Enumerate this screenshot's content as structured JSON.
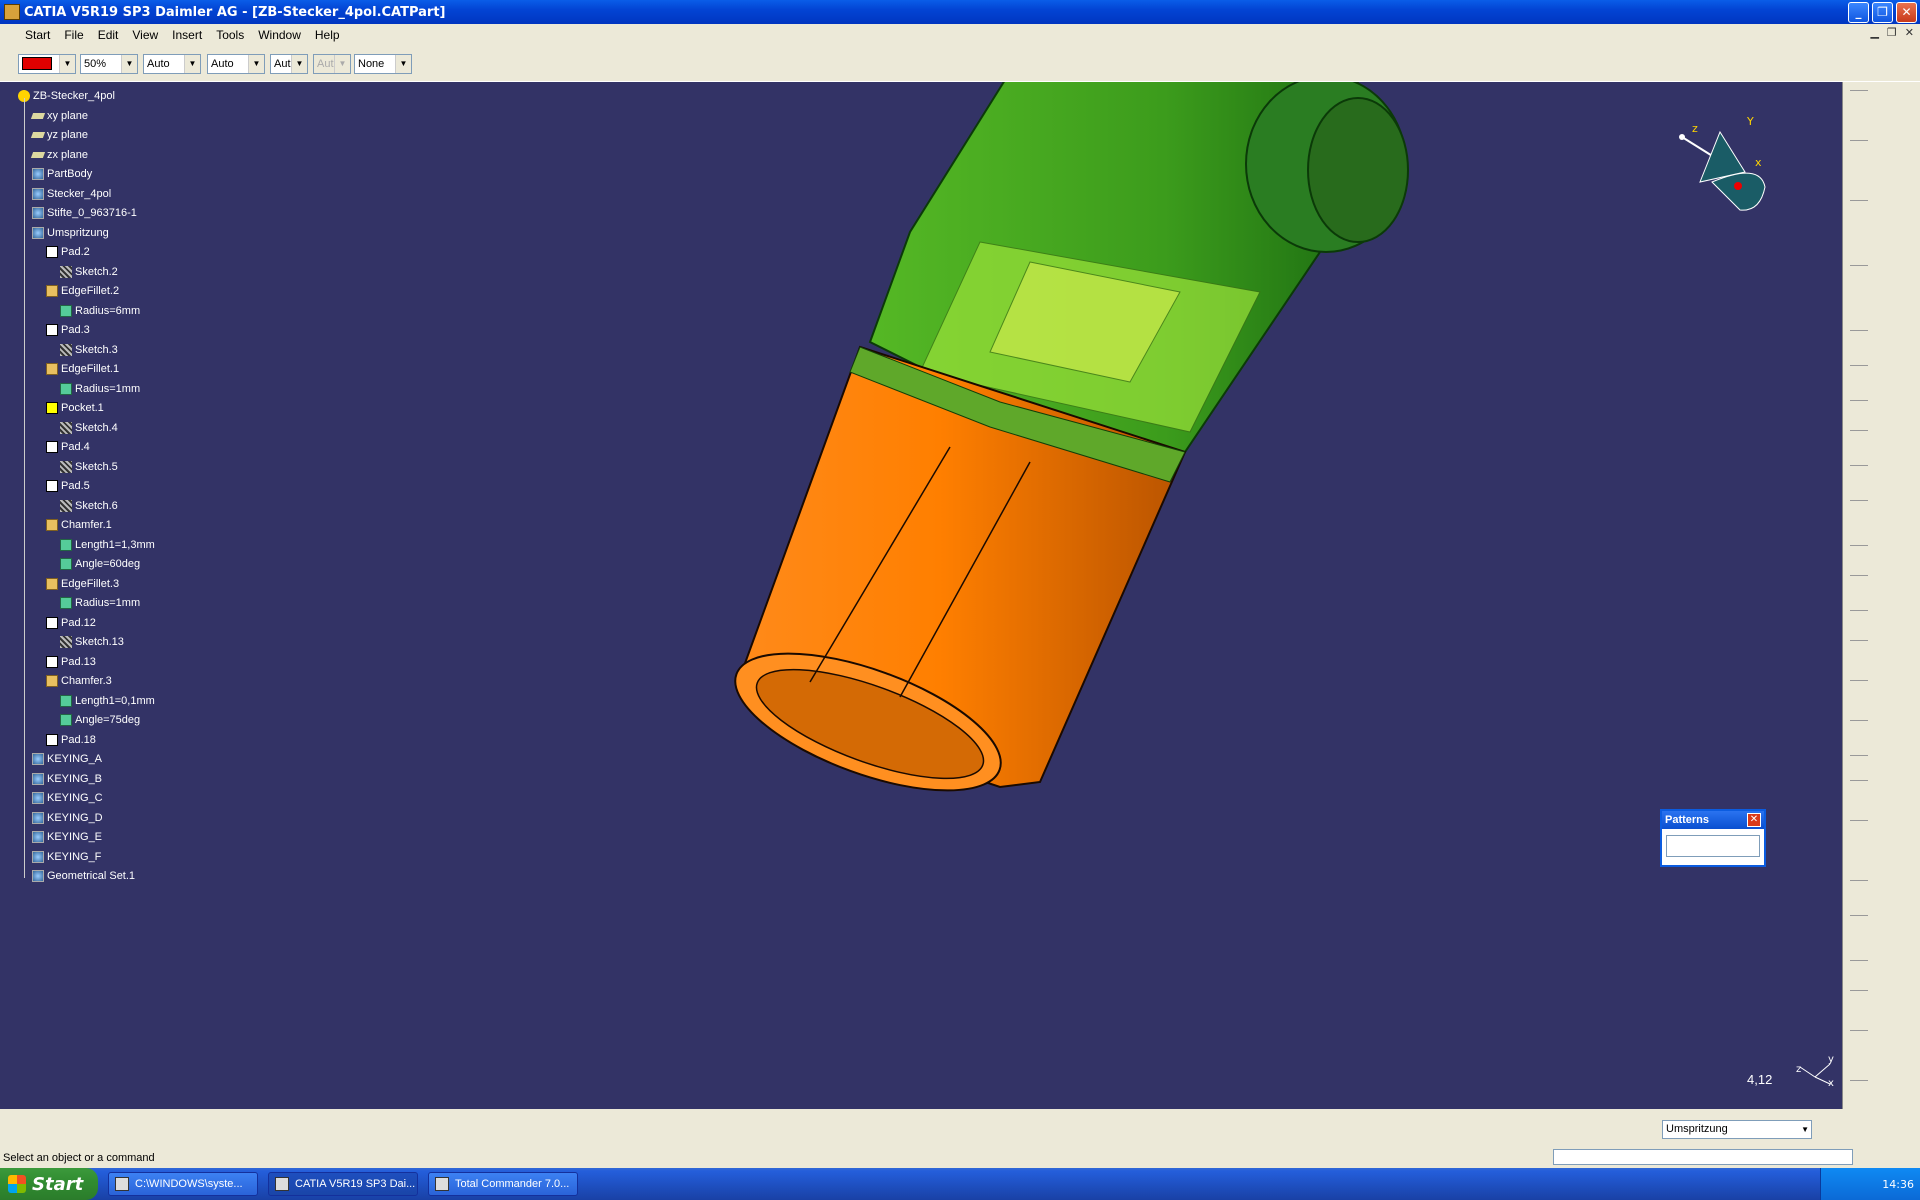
{
  "window": {
    "title": "CATIA V5R19 SP3 Daimler AG - [ZB-Stecker_4pol.CATPart]"
  },
  "menu": [
    "Start",
    "File",
    "Edit",
    "View",
    "Insert",
    "Tools",
    "Window",
    "Help"
  ],
  "toolbar": {
    "color": "#e00000",
    "transparency": "50%",
    "linetype": "Auto",
    "thickness": "Auto",
    "point": "Aut",
    "layer_disabled": "Aut",
    "layer": "None"
  },
  "tree": {
    "root": "ZB-Stecker_4pol",
    "nodes": [
      {
        "label": "xy plane",
        "icon": "plane-icon"
      },
      {
        "label": "yz plane",
        "icon": "plane-icon"
      },
      {
        "label": "zx plane",
        "icon": "plane-icon"
      },
      {
        "label": "PartBody",
        "icon": "body-icon"
      },
      {
        "label": "Stecker_4pol",
        "icon": "body-icon"
      },
      {
        "label": "Stifte_0_963716-1",
        "icon": "body-icon"
      },
      {
        "label": "Umspritzung",
        "icon": "body-icon"
      },
      {
        "label": "Pad.2",
        "icon": "pad-icon"
      },
      {
        "label": "Sketch.2",
        "icon": "sketch-icon"
      },
      {
        "label": "EdgeFillet.2",
        "icon": "fillet-icon"
      },
      {
        "label": "Radius=6mm",
        "icon": "parameter-icon"
      },
      {
        "label": "Pad.3",
        "icon": "pad-icon"
      },
      {
        "label": "Sketch.3",
        "icon": "sketch-icon"
      },
      {
        "label": "EdgeFillet.1",
        "icon": "fillet-icon"
      },
      {
        "label": "Radius=1mm",
        "icon": "parameter-icon"
      },
      {
        "label": "Pocket.1",
        "icon": "pocket-icon"
      },
      {
        "label": "Sketch.4",
        "icon": "sketch-icon"
      },
      {
        "label": "Pad.4",
        "icon": "pad-icon"
      },
      {
        "label": "Sketch.5",
        "icon": "sketch-icon"
      },
      {
        "label": "Pad.5",
        "icon": "pad-icon"
      },
      {
        "label": "Sketch.6",
        "icon": "sketch-icon"
      },
      {
        "label": "Chamfer.1",
        "icon": "chamfer-icon"
      },
      {
        "label": "Length1=1,3mm",
        "icon": "parameter-icon"
      },
      {
        "label": "Angle=60deg",
        "icon": "parameter-icon"
      },
      {
        "label": "EdgeFillet.3",
        "icon": "fillet-icon"
      },
      {
        "label": "Radius=1mm",
        "icon": "parameter-icon"
      },
      {
        "label": "Pad.12",
        "icon": "pad-icon"
      },
      {
        "label": "Sketch.13",
        "icon": "sketch-icon"
      },
      {
        "label": "Pad.13",
        "icon": "pad-icon"
      },
      {
        "label": "Chamfer.3",
        "icon": "chamfer-icon"
      },
      {
        "label": "Length1=0,1mm",
        "icon": "parameter-icon"
      },
      {
        "label": "Angle=75deg",
        "icon": "parameter-icon"
      },
      {
        "label": "Pad.18",
        "icon": "pad-icon"
      },
      {
        "label": "KEYING_A",
        "icon": "body-icon"
      },
      {
        "label": "KEYING_B",
        "icon": "body-icon"
      },
      {
        "label": "KEYING_C",
        "icon": "body-icon"
      },
      {
        "label": "KEYING_D",
        "icon": "body-icon"
      },
      {
        "label": "KEYING_E",
        "icon": "body-icon"
      },
      {
        "label": "KEYING_F",
        "icon": "body-icon"
      },
      {
        "label": "Geometrical Set.1",
        "icon": "geometrical-set-icon"
      }
    ]
  },
  "viewport": {
    "background": "#333366",
    "compass_labels": [
      "z",
      "Y",
      "x"
    ],
    "axis_labels": [
      "z",
      "y",
      "x"
    ],
    "scale": "4,12"
  },
  "patterns_dialog": {
    "title": "Patterns"
  },
  "status": {
    "prompt": "Select an object or a command",
    "workbench": "Umspritzung"
  },
  "taskbar": {
    "start": "Start",
    "tasks": [
      "C:\\WINDOWS\\syste...",
      "CATIA V5R19 SP3 Dai...",
      "Total Commander 7.0..."
    ],
    "clock": "14:36"
  }
}
